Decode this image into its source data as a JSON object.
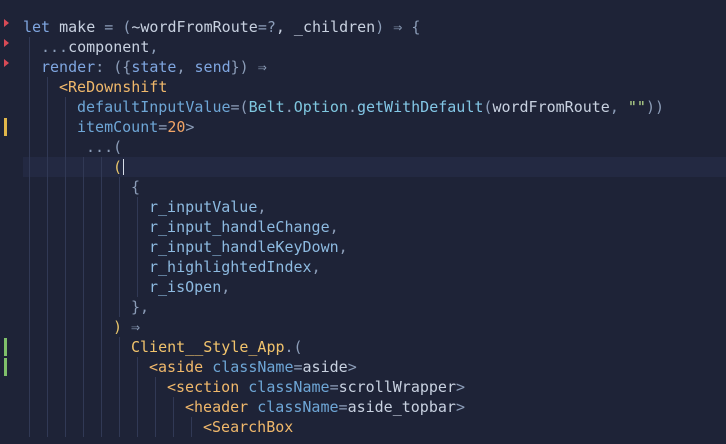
{
  "gutter": [
    {
      "type": "arrow",
      "line": 0,
      "color": "#d84a56"
    },
    {
      "type": "arrow",
      "line": 1,
      "color": "#d84a56"
    },
    {
      "type": "arrow",
      "line": 2,
      "color": "#d84a56"
    },
    {
      "type": "bar",
      "line": 5,
      "color": "#e0b64a"
    },
    {
      "type": "bar",
      "line": 16,
      "color": "#7fbf6a"
    },
    {
      "type": "bar",
      "line": 17,
      "color": "#7fbf6a"
    }
  ],
  "lines": [
    {
      "indent": 0,
      "guides": [],
      "tokens": [
        [
          "kw",
          "let "
        ],
        [
          "id",
          "make "
        ],
        [
          "op",
          "= ("
        ],
        [
          "id",
          "~wordFromRoute"
        ],
        [
          "op",
          "=?"
        ],
        [
          "id",
          ", _children"
        ],
        [
          "op",
          ") ⇒ {"
        ]
      ]
    },
    {
      "indent": 1,
      "guides": [
        1
      ],
      "tokens": [
        [
          "op",
          "..."
        ],
        [
          "id",
          "component"
        ],
        [
          "op",
          ","
        ]
      ]
    },
    {
      "indent": 1,
      "guides": [
        1
      ],
      "tokens": [
        [
          "kw",
          "render"
        ],
        [
          "op",
          ": ({"
        ],
        [
          "kw",
          "state"
        ],
        [
          "op",
          ", "
        ],
        [
          "kw",
          "send"
        ],
        [
          "op",
          "}) ⇒"
        ]
      ]
    },
    {
      "indent": 2,
      "guides": [
        1,
        2
      ],
      "tokens": [
        [
          "jsx",
          "<ReDownshift"
        ]
      ]
    },
    {
      "indent": 3,
      "guides": [
        1,
        2,
        3
      ],
      "tokens": [
        [
          "attr",
          "defaultInputValue"
        ],
        [
          "op",
          "=("
        ],
        [
          "mod",
          "Belt"
        ],
        [
          "op",
          "."
        ],
        [
          "mod",
          "Option"
        ],
        [
          "op",
          "."
        ],
        [
          "fn",
          "getWithDefault"
        ],
        [
          "op",
          "("
        ],
        [
          "id",
          "wordFromRoute"
        ],
        [
          "op",
          ", "
        ],
        [
          "str",
          "\"\""
        ],
        [
          "op",
          "))"
        ]
      ]
    },
    {
      "indent": 3,
      "guides": [
        1,
        2,
        3
      ],
      "tokens": [
        [
          "attr",
          "itemCount"
        ],
        [
          "op",
          "="
        ],
        [
          "num",
          "20"
        ],
        [
          "op",
          ">"
        ]
      ]
    },
    {
      "indent": 3,
      "guides": [
        1,
        2,
        3
      ],
      "tokens": [
        [
          "op",
          " ...("
        ]
      ]
    },
    {
      "indent": 5,
      "guides": [
        1,
        2,
        3,
        4,
        5
      ],
      "active": true,
      "cursor": true,
      "tokens": [
        [
          "paren",
          "("
        ]
      ]
    },
    {
      "indent": 6,
      "guides": [
        1,
        2,
        3,
        4,
        5,
        6
      ],
      "tokens": [
        [
          "op",
          "{"
        ]
      ]
    },
    {
      "indent": 7,
      "guides": [
        1,
        2,
        3,
        4,
        5,
        6,
        7
      ],
      "tokens": [
        [
          "field",
          "r_inputValue"
        ],
        [
          "op",
          ","
        ]
      ]
    },
    {
      "indent": 7,
      "guides": [
        1,
        2,
        3,
        4,
        5,
        6,
        7
      ],
      "tokens": [
        [
          "field",
          "r_input_handleChange"
        ],
        [
          "op",
          ","
        ]
      ]
    },
    {
      "indent": 7,
      "guides": [
        1,
        2,
        3,
        4,
        5,
        6,
        7
      ],
      "tokens": [
        [
          "field",
          "r_input_handleKeyDown"
        ],
        [
          "op",
          ","
        ]
      ]
    },
    {
      "indent": 7,
      "guides": [
        1,
        2,
        3,
        4,
        5,
        6,
        7
      ],
      "tokens": [
        [
          "field",
          "r_highlightedIndex"
        ],
        [
          "op",
          ","
        ]
      ]
    },
    {
      "indent": 7,
      "guides": [
        1,
        2,
        3,
        4,
        5,
        6,
        7
      ],
      "tokens": [
        [
          "field",
          "r_isOpen"
        ],
        [
          "op",
          ","
        ]
      ]
    },
    {
      "indent": 6,
      "guides": [
        1,
        2,
        3,
        4,
        5,
        6
      ],
      "tokens": [
        [
          "op",
          "},"
        ]
      ]
    },
    {
      "indent": 5,
      "guides": [
        1,
        2,
        3,
        4,
        5
      ],
      "tokens": [
        [
          "paren",
          ")"
        ],
        [
          "op",
          " ⇒"
        ]
      ]
    },
    {
      "indent": 6,
      "guides": [
        1,
        2,
        3,
        4,
        5,
        6
      ],
      "tokens": [
        [
          "client",
          "Client__Style_App"
        ],
        [
          "op",
          ".("
        ]
      ]
    },
    {
      "indent": 7,
      "guides": [
        1,
        2,
        3,
        4,
        5,
        6,
        7
      ],
      "tokens": [
        [
          "jsx",
          "<aside "
        ],
        [
          "attr",
          "className"
        ],
        [
          "op",
          "="
        ],
        [
          "id",
          "aside"
        ],
        [
          "op",
          ">"
        ]
      ]
    },
    {
      "indent": 8,
      "guides": [
        1,
        2,
        3,
        4,
        5,
        6,
        7,
        8
      ],
      "tokens": [
        [
          "jsx",
          "<section "
        ],
        [
          "attr",
          "className"
        ],
        [
          "op",
          "="
        ],
        [
          "id",
          "scrollWrapper"
        ],
        [
          "op",
          ">"
        ]
      ]
    },
    {
      "indent": 9,
      "guides": [
        1,
        2,
        3,
        4,
        5,
        6,
        7,
        8,
        9
      ],
      "tokens": [
        [
          "jsx",
          "<header "
        ],
        [
          "attr",
          "className"
        ],
        [
          "op",
          "="
        ],
        [
          "id",
          "aside_topbar"
        ],
        [
          "op",
          ">"
        ]
      ]
    },
    {
      "indent": 10,
      "guides": [
        1,
        2,
        3,
        4,
        5,
        6,
        7,
        8,
        9,
        10
      ],
      "tokens": [
        [
          "jsx",
          "<SearchBox"
        ]
      ]
    }
  ]
}
